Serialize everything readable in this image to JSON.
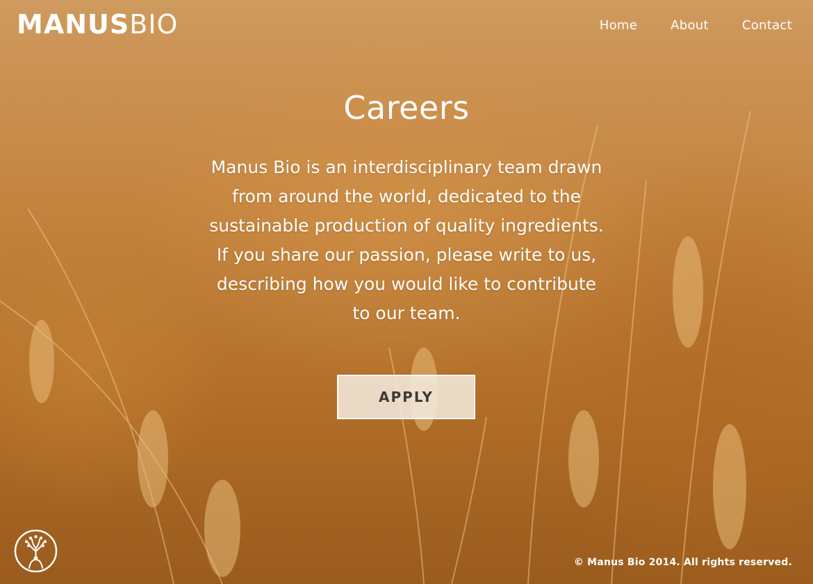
{
  "brand": {
    "name_bold": "MANUS",
    "name_thin": "BIO"
  },
  "nav": {
    "items": [
      {
        "label": "Home"
      },
      {
        "label": "About"
      },
      {
        "label": "Contact"
      }
    ]
  },
  "hero": {
    "title": "Careers",
    "body": "Manus Bio is an interdisciplinary team drawn from around the world, dedicated to the sustainable production of quality ingredients. If you share our passion, please write to us, describing how you would like to contribute to our team.",
    "apply_label": "APPLY"
  },
  "footer": {
    "copyright": "© Manus Bio 2014. All rights reserved."
  },
  "icons": {
    "emblem": "tree-person-emblem-icon"
  },
  "colors": {
    "text": "#ffffff",
    "button_bg": "#f5ece0",
    "button_text": "#3c3a36",
    "background": "#b8742a"
  }
}
